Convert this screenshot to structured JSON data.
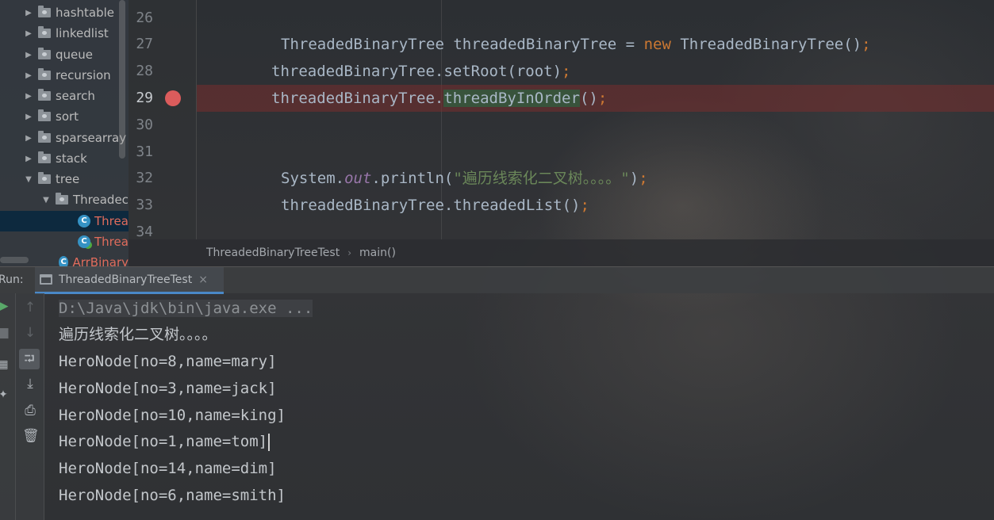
{
  "project_tree": {
    "items": [
      {
        "label": "hashtable",
        "kind": "folder",
        "expanded": false
      },
      {
        "label": "linkedlist",
        "kind": "folder",
        "expanded": false
      },
      {
        "label": "queue",
        "kind": "folder",
        "expanded": false
      },
      {
        "label": "recursion",
        "kind": "folder",
        "expanded": false
      },
      {
        "label": "search",
        "kind": "folder",
        "expanded": false
      },
      {
        "label": "sort",
        "kind": "folder",
        "expanded": false
      },
      {
        "label": "sparsearray",
        "kind": "folder",
        "expanded": false
      },
      {
        "label": "stack",
        "kind": "folder",
        "expanded": false
      },
      {
        "label": "tree",
        "kind": "folder",
        "expanded": true
      },
      {
        "label": "Threadec",
        "kind": "folder",
        "expanded": true
      },
      {
        "label": "Threa",
        "kind": "class",
        "selected": true
      },
      {
        "label": "Threa",
        "kind": "test-class"
      },
      {
        "label": "ArrBinary",
        "kind": "class"
      }
    ],
    "class_icon_letter": "C"
  },
  "editor": {
    "line_numbers": [
      "26",
      "27",
      "28",
      "29",
      "30",
      "31",
      "32",
      "33",
      "34"
    ],
    "breakpoint_line": "29",
    "code": {
      "l27_a": "ThreadedBinaryTree threadedBinaryTree = ",
      "l27_kw": "new",
      "l27_b": " ThreadedBinaryTree()",
      "l27_semi": ";",
      "l28_a": "threadedBinaryTree.setRoot(root)",
      "l28_semi": ";",
      "l29_a": "threadedBinaryTree.",
      "l29_hl": "threadByInOrder",
      "l29_b": "()",
      "l29_semi": ";",
      "l32_a": "System.",
      "l32_field": "out",
      "l32_b": ".println(",
      "l32_str": "\"遍历线索化二叉树。。。。\"",
      "l32_c": ")",
      "l32_semi": ";",
      "l33_a": "threadedBinaryTree.threadedList()",
      "l33_semi": ";"
    }
  },
  "breadcrumb": {
    "class_name": "ThreadedBinaryTreeTest",
    "separator": "›",
    "method": "main()"
  },
  "run_panel": {
    "label": "Run:",
    "tab_title": "ThreadedBinaryTreeTest",
    "close_glyph": "×",
    "output": [
      "D:\\Java\\jdk\\bin\\java.exe ...",
      "遍历线索化二叉树。。。。",
      "HeroNode[no=8,name=mary]",
      "HeroNode[no=3,name=jack]",
      "HeroNode[no=10,name=king]",
      "HeroNode[no=1,name=tom]",
      "HeroNode[no=14,name=dim]",
      "HeroNode[no=6,name=smith]"
    ]
  },
  "colors": {
    "keyword": "#cc7832",
    "field": "#9876aa",
    "string": "#6a8759",
    "breakpoint": "#db5c5c",
    "tab_underline": "#4a88c7"
  }
}
